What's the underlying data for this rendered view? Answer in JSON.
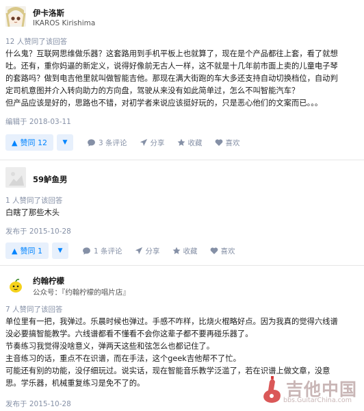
{
  "answers": [
    {
      "author": {
        "name": "伊卡洛斯",
        "subtitle": "IKAROS Kirishima"
      },
      "vote_info": "12 人赞同了该回答",
      "paragraphs": [
        "什么鬼？互联网思维做乐器？这套路用到手机平板上也就算了，现在是个产品都往上套，看了就想",
        "吐。还有，重你妈逼的新定义，说得好像前无古人一样，这不就是十几年前市面上卖的儿童电子琴",
        "的套路吗？做到电吉他里就叫做智能吉他。那现在满大街跑的车大多还支持自动切换档位，自动判",
        "定司机意图并介入转向助力的方向盘，驾驶从来没有如此简单过，怎么不叫智能汽车？",
        "但产品应该是好的，思路也不错，对初学者来说应该挺好玩的，只是恶心他们的文案而已。。。"
      ],
      "date": "编辑于 2018-03-11",
      "vote_label": "赞同 12",
      "comments": "3 条评论",
      "share": "分享",
      "collect": "收藏",
      "like": "喜欢"
    },
    {
      "author": {
        "name": "59鲈鱼男"
      },
      "vote_info": "1 人赞同了该回答",
      "paragraphs": [
        "白瞎了那些木头"
      ],
      "date": "发布于 2015-10-28",
      "vote_label": "赞同 1",
      "comments": "1 条评论",
      "share": "分享",
      "collect": "收藏",
      "like": "喜欢"
    },
    {
      "author": {
        "name": "约翰柠檬",
        "badge": "公众号：『约翰柠檬的唱片店』"
      },
      "vote_info": "7 人赞同了该回答",
      "paragraphs": [
        "单位里有一把，我弹过。乐晨时候也弹过。手感不咋样，比烧火棍略好点。因为我真的觉得六线谱",
        "没必要搞智能教学。六线谱都看不懂看不会你这辈子都不要再碰乐器了。",
        "节奏练习我觉得没啥意义，弹两天这些和弦怎么也都记住了。",
        "主音练习的话，重点不在识谱，而在手法，这个geek吉他帮不了忙。",
        "可能还有别的功能，没仔细玩过。说实话，现在智能音乐教学泛滥了，若在识谱上做文章，没意",
        "思。学乐器，机械重复练习是免不了的。"
      ],
      "date": "发布于 2015-10-28"
    }
  ],
  "watermark": {
    "big": "吉他中国",
    "small": "bbs.GuitarChina.com"
  }
}
